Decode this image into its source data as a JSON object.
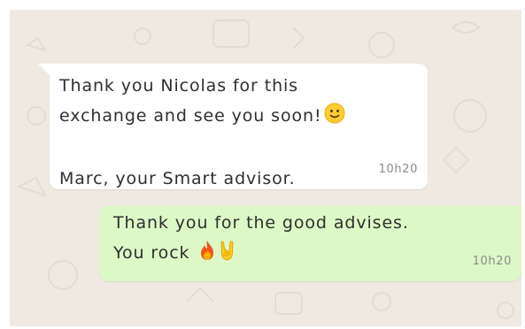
{
  "messages": [
    {
      "direction": "incoming",
      "lines": [
        "Thank you Nicolas for this",
        "exchange and see you soon!",
        "",
        "Marc, your Smart advisor."
      ],
      "emoji": [
        "slightly-smiling-face"
      ],
      "time": "10h20"
    },
    {
      "direction": "outgoing",
      "lines": [
        "Thank you for the good advises.",
        "You rock"
      ],
      "emoji": [
        "fire",
        "sign-of-the-horns"
      ],
      "time": "10h20"
    }
  ],
  "colors": {
    "chat_background": "#efe9e1",
    "incoming_bubble": "#ffffff",
    "outgoing_bubble": "#dcf8c6",
    "text": "#2f2f2f",
    "timestamp": "#8b8b8b"
  }
}
